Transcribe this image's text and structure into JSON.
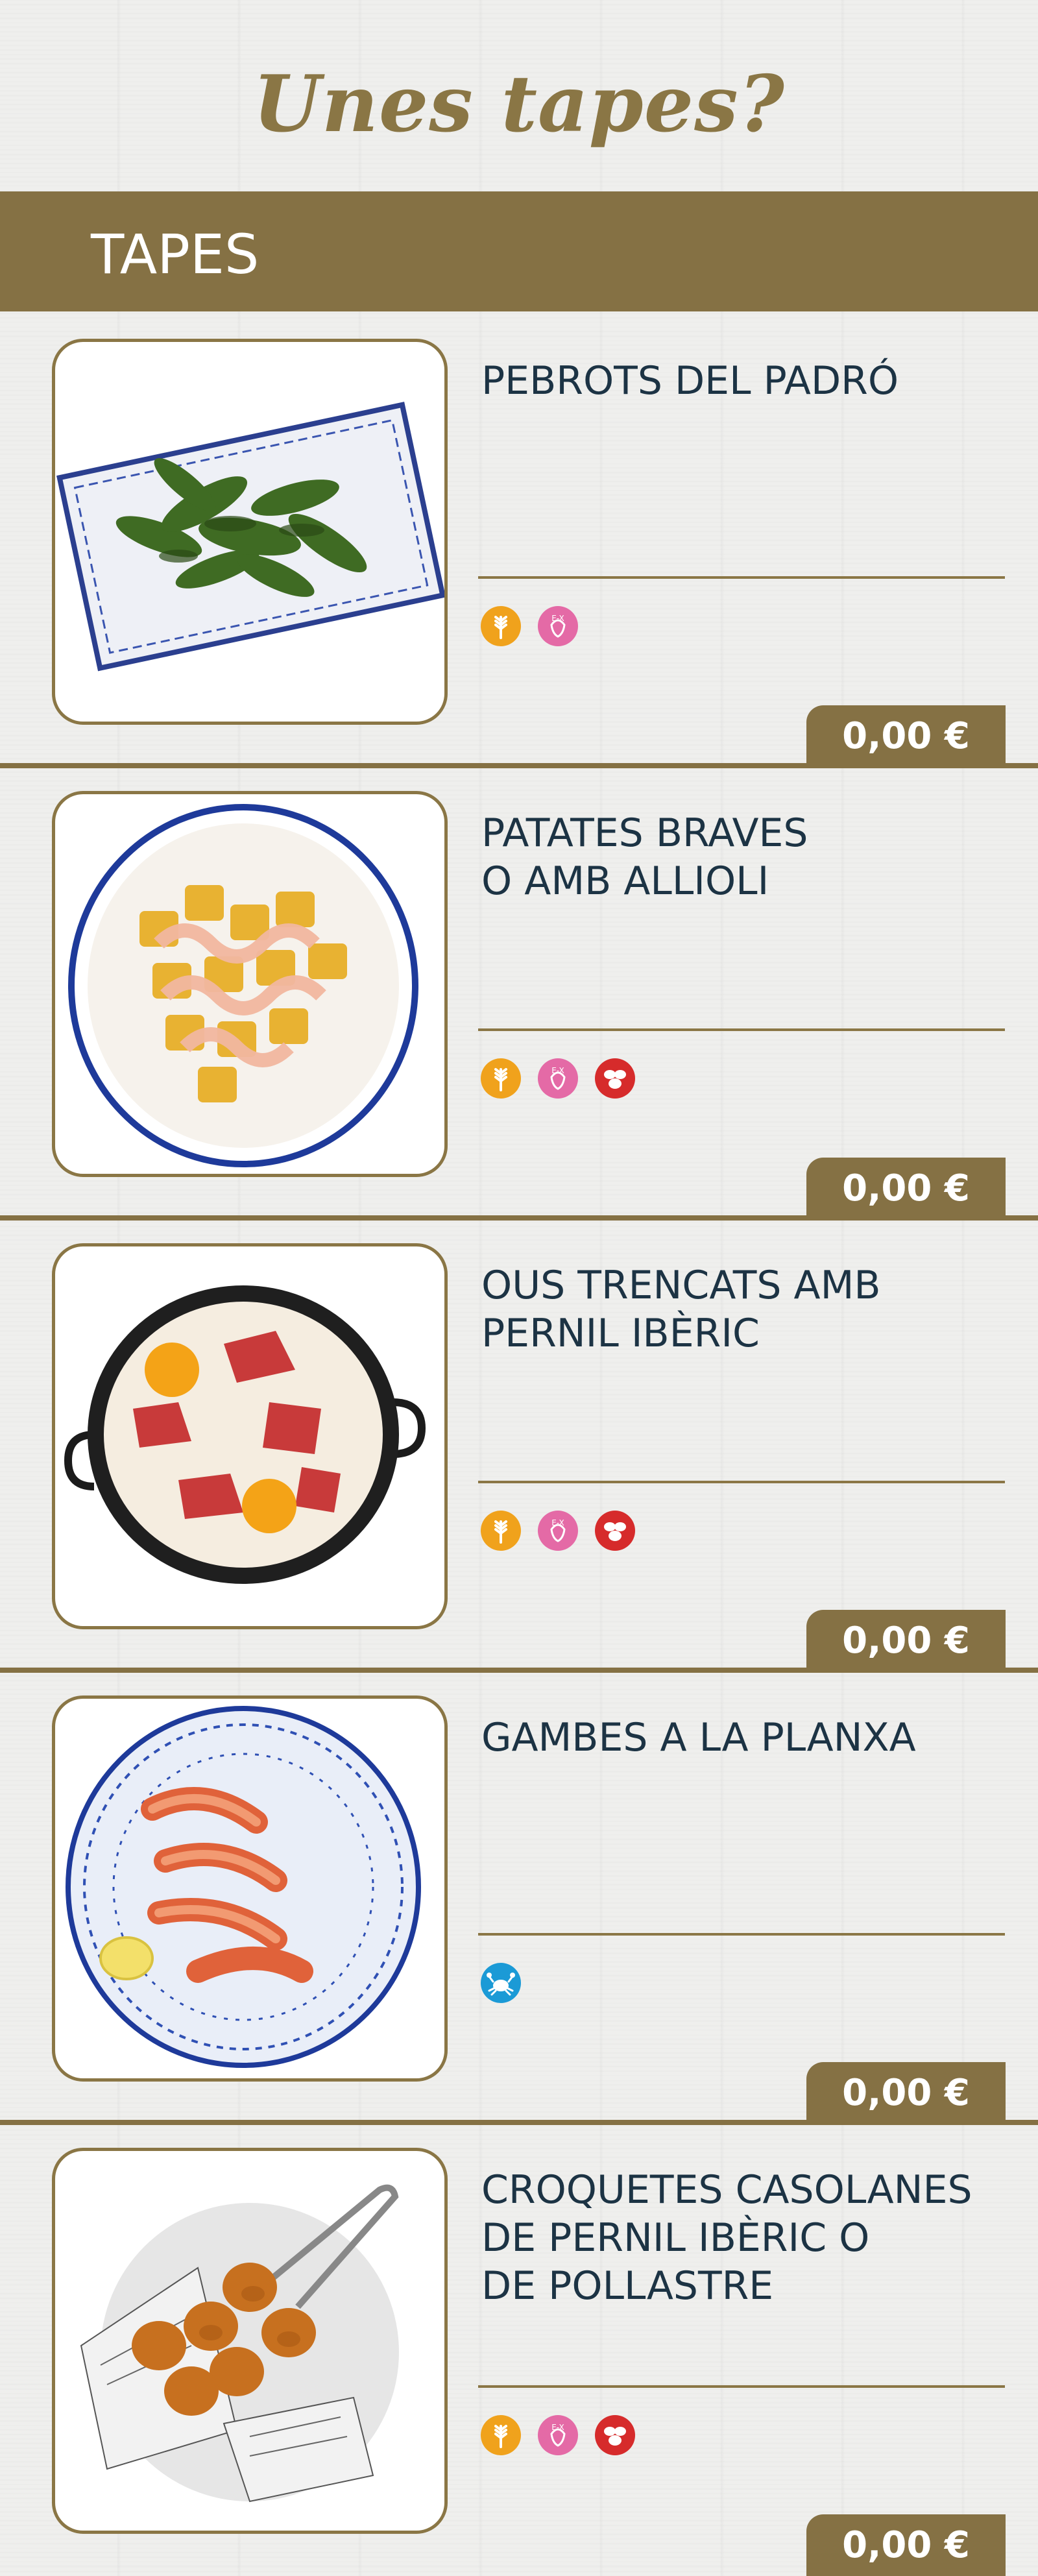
{
  "page": {
    "title": "Unes tapes?"
  },
  "section": {
    "label": "TAPES"
  },
  "colors": {
    "accent": "#857144",
    "text": "#1c3344",
    "gluten": "#f0a21c",
    "lactose": "#e46aa6",
    "nuts": "#d62b2b",
    "crustacean": "#1b9ad6"
  },
  "items": [
    {
      "name": "PEBROTS DEL PADRÓ",
      "price": "0,00 €",
      "allergens": [
        "gluten-icon",
        "lactose-free-icon"
      ]
    },
    {
      "name": "PATATES BRAVES\nO AMB ALLIOLI",
      "price": "0,00 €",
      "allergens": [
        "gluten-icon",
        "lactose-free-icon",
        "nuts-icon"
      ]
    },
    {
      "name": "OUS TRENCATS AMB\nPERNIL IBÈRIC",
      "price": "0,00 €",
      "allergens": [
        "gluten-icon",
        "lactose-free-icon",
        "nuts-icon"
      ]
    },
    {
      "name": "GAMBES A LA PLANXA",
      "price": "0,00 €",
      "allergens": [
        "crustacean-icon"
      ]
    },
    {
      "name": "CROQUETES CASOLANES\nDE PERNIL IBÈRIC O\nDE POLLASTRE",
      "price": "0,00 €",
      "allergens": [
        "gluten-icon",
        "lactose-free-icon",
        "nuts-icon"
      ]
    }
  ]
}
